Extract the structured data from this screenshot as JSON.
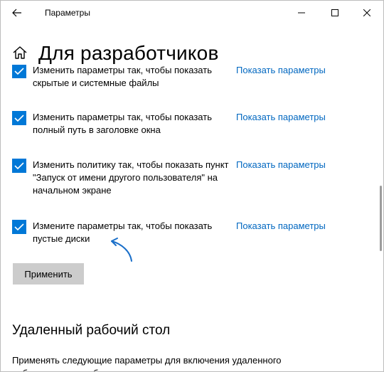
{
  "window": {
    "title": "Параметры",
    "controls": {
      "back": "back-arrow-icon",
      "minimize": "minimize-icon",
      "maximize": "maximize-icon",
      "close": "close-icon"
    }
  },
  "header": {
    "title": "Для разработчиков",
    "home_icon": "home-icon"
  },
  "options": [
    {
      "checked": true,
      "text": "Изменить параметры так, чтобы показать скрытые и системные файлы",
      "link": "Показать параметры"
    },
    {
      "checked": true,
      "text": "Изменить параметры так, чтобы показать полный путь в заголовке окна",
      "link": "Показать параметры"
    },
    {
      "checked": true,
      "text": "Изменить политику так, чтобы показать пункт \"Запуск от имени другого пользователя\" на начальном экране",
      "link": "Показать параметры"
    },
    {
      "checked": true,
      "text": "Измените параметры так, чтобы показать пустые диски",
      "link": "Показать параметры"
    }
  ],
  "apply_button": "Применить",
  "remote_desktop": {
    "title": "Удаленный рабочий стол",
    "text": "Применять следующие параметры для включения удаленного рабочего стола и обеспечения доступности компьютера"
  },
  "colors": {
    "accent": "#0078d7",
    "link": "#0067c0",
    "button_bg": "#cccccc",
    "annotation_arrow": "#1a6fc9"
  }
}
